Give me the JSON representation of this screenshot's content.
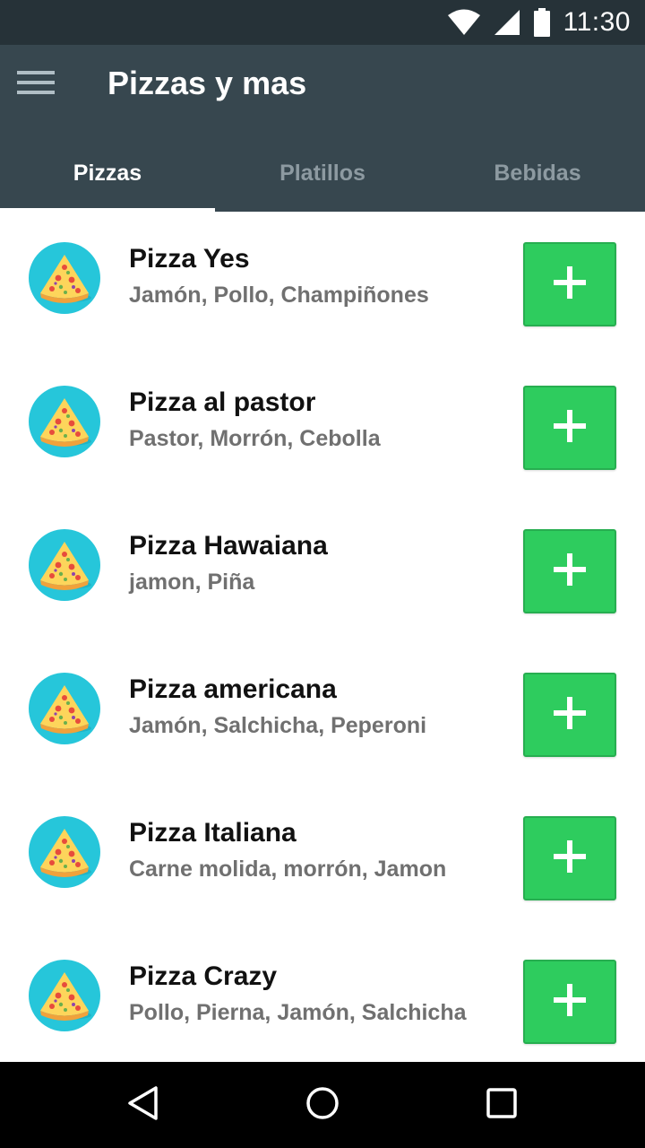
{
  "status_bar": {
    "time": "11:30",
    "icons": [
      "wifi-icon",
      "cell-signal-icon",
      "battery-icon"
    ]
  },
  "app_bar": {
    "title": "Pizzas y mas",
    "menu_icon": "hamburger-menu-icon"
  },
  "tabs": [
    {
      "label": "Pizzas",
      "active": true
    },
    {
      "label": "Platillos",
      "active": false
    },
    {
      "label": "Bebidas",
      "active": false
    }
  ],
  "items": [
    {
      "title": "Pizza Yes",
      "subtitle": "Jamón, Pollo, Champiñones",
      "icon": "pizza-slice-icon"
    },
    {
      "title": "Pizza al pastor",
      "subtitle": "Pastor, Morrón, Cebolla",
      "icon": "pizza-slice-icon"
    },
    {
      "title": "Pizza Hawaiana",
      "subtitle": "jamon, Piña",
      "icon": "pizza-slice-icon"
    },
    {
      "title": "Pizza americana",
      "subtitle": "Jamón, Salchicha, Peperoni",
      "icon": "pizza-slice-icon"
    },
    {
      "title": "Pizza Italiana",
      "subtitle": "Carne molida, morrón, Jamon",
      "icon": "pizza-slice-icon"
    },
    {
      "title": "Pizza Crazy",
      "subtitle": "Pollo, Pierna, Jamón, Salchicha",
      "icon": "pizza-slice-icon"
    }
  ],
  "nav_bar": {
    "icons": [
      "back-icon",
      "home-icon",
      "recents-icon"
    ]
  },
  "colors": {
    "status_bar": "#263238",
    "app_bar": "#37474f",
    "tab_inactive": "#8d9aa1",
    "add_button": "#2ecc5e",
    "avatar_bg": "#26c6da",
    "subtitle": "#707070"
  }
}
